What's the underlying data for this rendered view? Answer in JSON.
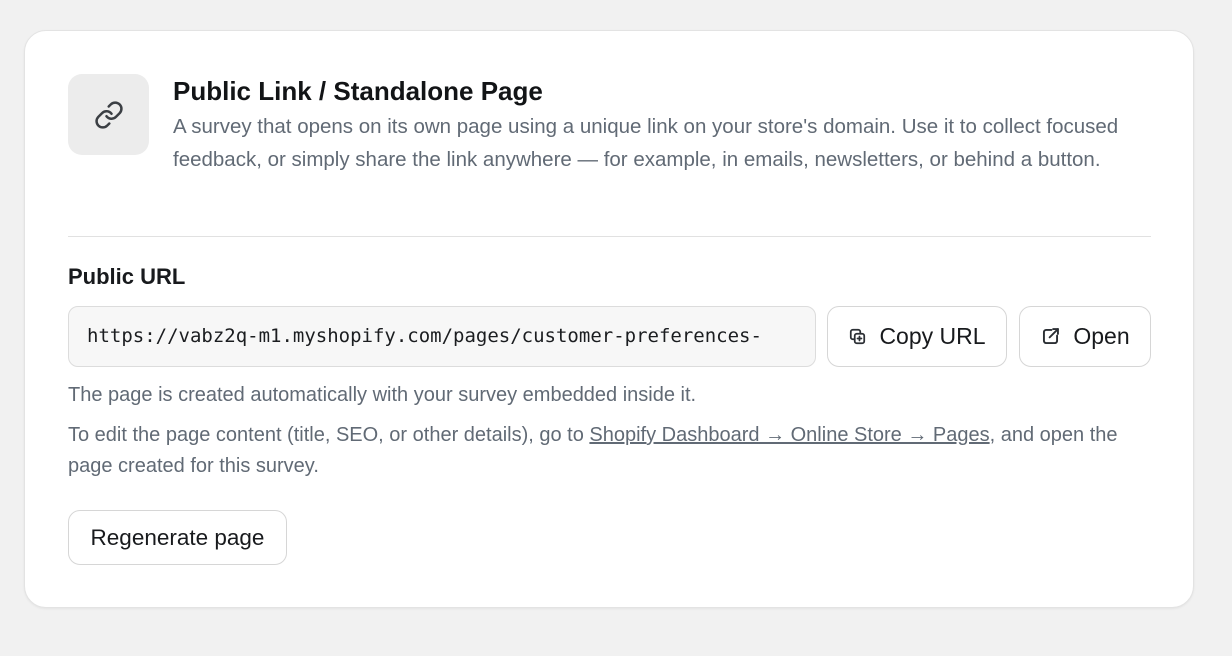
{
  "card": {
    "title": "Public Link / Standalone Page",
    "description": "A survey that opens on its own page using a unique link on your store's domain. Use it to collect focused feedback, or simply share the link anywhere — for example, in emails, newsletters, or behind a button."
  },
  "public_url": {
    "label": "Public URL",
    "value": "https://vabz2q-m1.myshopify.com/pages/customer-preferences-"
  },
  "buttons": {
    "copy_label": "Copy URL",
    "open_label": "Open",
    "regenerate_label": "Regenerate page"
  },
  "notes": {
    "auto_created": "The page is created automatically with your survey embedded inside it.",
    "edit_prefix": "To edit the page content (title, SEO, or other details), go to ",
    "edit_link": "Shopify Dashboard → Online Store → Pages",
    "edit_suffix": ", and open the page created for this survey."
  },
  "icons": {
    "header": "link-icon",
    "copy": "copy-icon",
    "open": "external-link-icon"
  }
}
